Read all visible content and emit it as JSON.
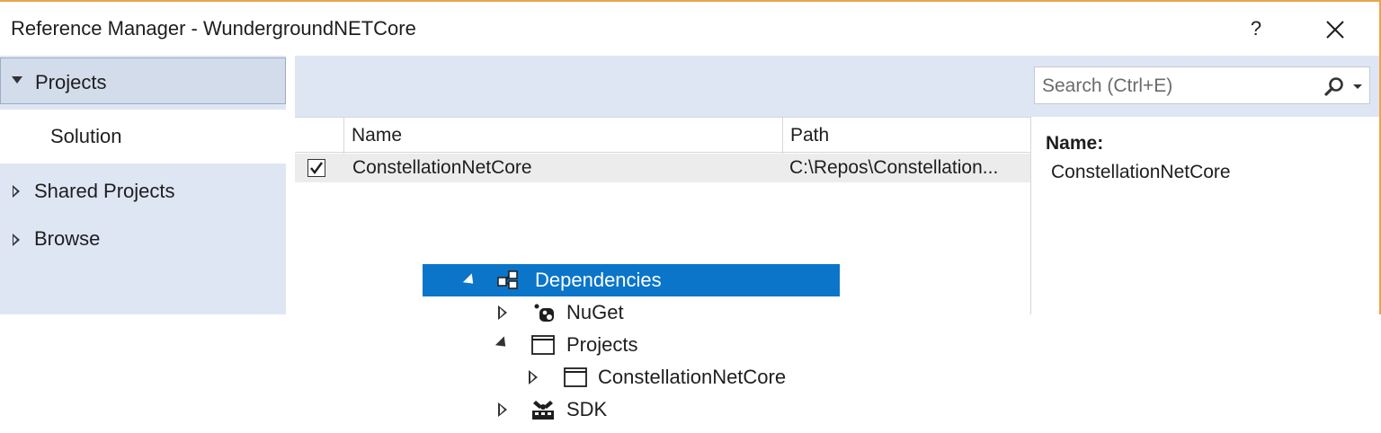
{
  "window": {
    "title": "Reference Manager - WundergroundNETCore",
    "help_label": "?"
  },
  "left_nav": {
    "items": [
      {
        "label": "Projects",
        "expanded": true,
        "selected": true
      },
      {
        "label": "Solution",
        "active": true
      },
      {
        "label": "Shared Projects",
        "expanded": false
      },
      {
        "label": "Browse",
        "expanded": false
      }
    ]
  },
  "search": {
    "placeholder": "Search (Ctrl+E)"
  },
  "grid": {
    "columns": [
      "",
      "Name",
      "Path"
    ],
    "rows": [
      {
        "checked": true,
        "name": "ConstellationNetCore",
        "path": "C:\\Repos\\Constellation..."
      }
    ]
  },
  "details": {
    "label": "Name:",
    "value": "ConstellationNetCore"
  },
  "solution_explorer": {
    "nodes": [
      {
        "label": "Dependencies",
        "icon": "dependencies-icon",
        "expanded": true,
        "selected": true
      },
      {
        "label": "NuGet",
        "icon": "nuget-icon",
        "expanded": false
      },
      {
        "label": "Projects",
        "icon": "project-window-icon",
        "expanded": true
      },
      {
        "label": "ConstellationNetCore",
        "icon": "project-window-icon",
        "expanded": false
      },
      {
        "label": "SDK",
        "icon": "sdk-icon",
        "expanded": false
      }
    ]
  },
  "colors": {
    "title_border": "#e8a550",
    "nav_background": "#dfe6f3",
    "selection_blue": "#0a75c9"
  }
}
